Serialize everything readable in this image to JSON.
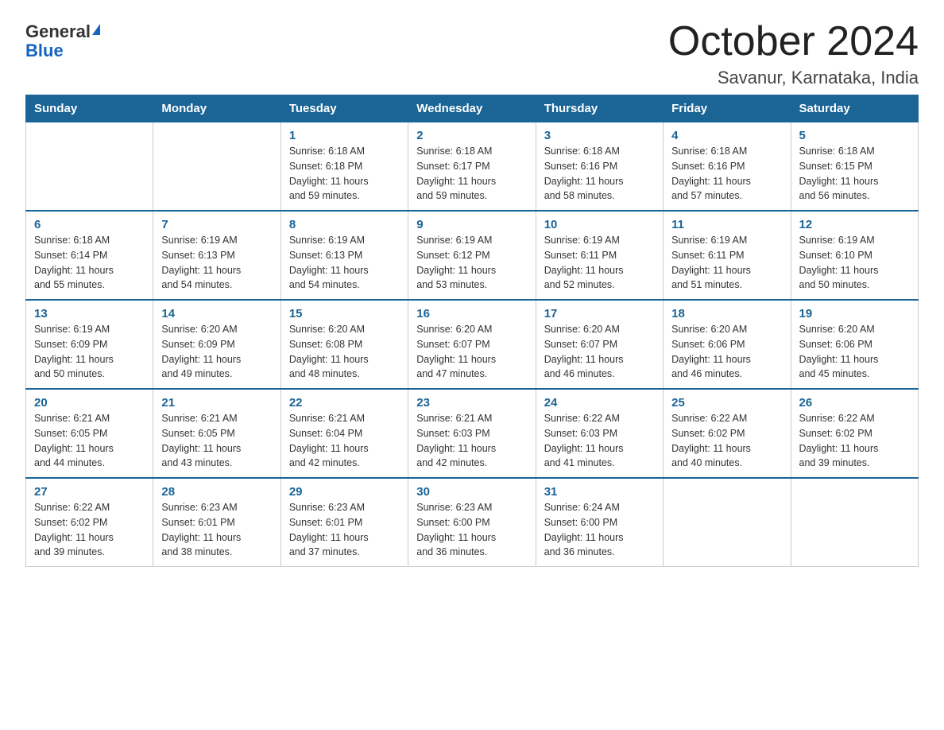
{
  "header": {
    "logo_general": "General",
    "logo_blue": "Blue",
    "month_year": "October 2024",
    "location": "Savanur, Karnataka, India"
  },
  "days_of_week": [
    "Sunday",
    "Monday",
    "Tuesday",
    "Wednesday",
    "Thursday",
    "Friday",
    "Saturday"
  ],
  "weeks": [
    [
      {
        "day": "",
        "info": ""
      },
      {
        "day": "",
        "info": ""
      },
      {
        "day": "1",
        "info": "Sunrise: 6:18 AM\nSunset: 6:18 PM\nDaylight: 11 hours\nand 59 minutes."
      },
      {
        "day": "2",
        "info": "Sunrise: 6:18 AM\nSunset: 6:17 PM\nDaylight: 11 hours\nand 59 minutes."
      },
      {
        "day": "3",
        "info": "Sunrise: 6:18 AM\nSunset: 6:16 PM\nDaylight: 11 hours\nand 58 minutes."
      },
      {
        "day": "4",
        "info": "Sunrise: 6:18 AM\nSunset: 6:16 PM\nDaylight: 11 hours\nand 57 minutes."
      },
      {
        "day": "5",
        "info": "Sunrise: 6:18 AM\nSunset: 6:15 PM\nDaylight: 11 hours\nand 56 minutes."
      }
    ],
    [
      {
        "day": "6",
        "info": "Sunrise: 6:18 AM\nSunset: 6:14 PM\nDaylight: 11 hours\nand 55 minutes."
      },
      {
        "day": "7",
        "info": "Sunrise: 6:19 AM\nSunset: 6:13 PM\nDaylight: 11 hours\nand 54 minutes."
      },
      {
        "day": "8",
        "info": "Sunrise: 6:19 AM\nSunset: 6:13 PM\nDaylight: 11 hours\nand 54 minutes."
      },
      {
        "day": "9",
        "info": "Sunrise: 6:19 AM\nSunset: 6:12 PM\nDaylight: 11 hours\nand 53 minutes."
      },
      {
        "day": "10",
        "info": "Sunrise: 6:19 AM\nSunset: 6:11 PM\nDaylight: 11 hours\nand 52 minutes."
      },
      {
        "day": "11",
        "info": "Sunrise: 6:19 AM\nSunset: 6:11 PM\nDaylight: 11 hours\nand 51 minutes."
      },
      {
        "day": "12",
        "info": "Sunrise: 6:19 AM\nSunset: 6:10 PM\nDaylight: 11 hours\nand 50 minutes."
      }
    ],
    [
      {
        "day": "13",
        "info": "Sunrise: 6:19 AM\nSunset: 6:09 PM\nDaylight: 11 hours\nand 50 minutes."
      },
      {
        "day": "14",
        "info": "Sunrise: 6:20 AM\nSunset: 6:09 PM\nDaylight: 11 hours\nand 49 minutes."
      },
      {
        "day": "15",
        "info": "Sunrise: 6:20 AM\nSunset: 6:08 PM\nDaylight: 11 hours\nand 48 minutes."
      },
      {
        "day": "16",
        "info": "Sunrise: 6:20 AM\nSunset: 6:07 PM\nDaylight: 11 hours\nand 47 minutes."
      },
      {
        "day": "17",
        "info": "Sunrise: 6:20 AM\nSunset: 6:07 PM\nDaylight: 11 hours\nand 46 minutes."
      },
      {
        "day": "18",
        "info": "Sunrise: 6:20 AM\nSunset: 6:06 PM\nDaylight: 11 hours\nand 46 minutes."
      },
      {
        "day": "19",
        "info": "Sunrise: 6:20 AM\nSunset: 6:06 PM\nDaylight: 11 hours\nand 45 minutes."
      }
    ],
    [
      {
        "day": "20",
        "info": "Sunrise: 6:21 AM\nSunset: 6:05 PM\nDaylight: 11 hours\nand 44 minutes."
      },
      {
        "day": "21",
        "info": "Sunrise: 6:21 AM\nSunset: 6:05 PM\nDaylight: 11 hours\nand 43 minutes."
      },
      {
        "day": "22",
        "info": "Sunrise: 6:21 AM\nSunset: 6:04 PM\nDaylight: 11 hours\nand 42 minutes."
      },
      {
        "day": "23",
        "info": "Sunrise: 6:21 AM\nSunset: 6:03 PM\nDaylight: 11 hours\nand 42 minutes."
      },
      {
        "day": "24",
        "info": "Sunrise: 6:22 AM\nSunset: 6:03 PM\nDaylight: 11 hours\nand 41 minutes."
      },
      {
        "day": "25",
        "info": "Sunrise: 6:22 AM\nSunset: 6:02 PM\nDaylight: 11 hours\nand 40 minutes."
      },
      {
        "day": "26",
        "info": "Sunrise: 6:22 AM\nSunset: 6:02 PM\nDaylight: 11 hours\nand 39 minutes."
      }
    ],
    [
      {
        "day": "27",
        "info": "Sunrise: 6:22 AM\nSunset: 6:02 PM\nDaylight: 11 hours\nand 39 minutes."
      },
      {
        "day": "28",
        "info": "Sunrise: 6:23 AM\nSunset: 6:01 PM\nDaylight: 11 hours\nand 38 minutes."
      },
      {
        "day": "29",
        "info": "Sunrise: 6:23 AM\nSunset: 6:01 PM\nDaylight: 11 hours\nand 37 minutes."
      },
      {
        "day": "30",
        "info": "Sunrise: 6:23 AM\nSunset: 6:00 PM\nDaylight: 11 hours\nand 36 minutes."
      },
      {
        "day": "31",
        "info": "Sunrise: 6:24 AM\nSunset: 6:00 PM\nDaylight: 11 hours\nand 36 minutes."
      },
      {
        "day": "",
        "info": ""
      },
      {
        "day": "",
        "info": ""
      }
    ]
  ]
}
